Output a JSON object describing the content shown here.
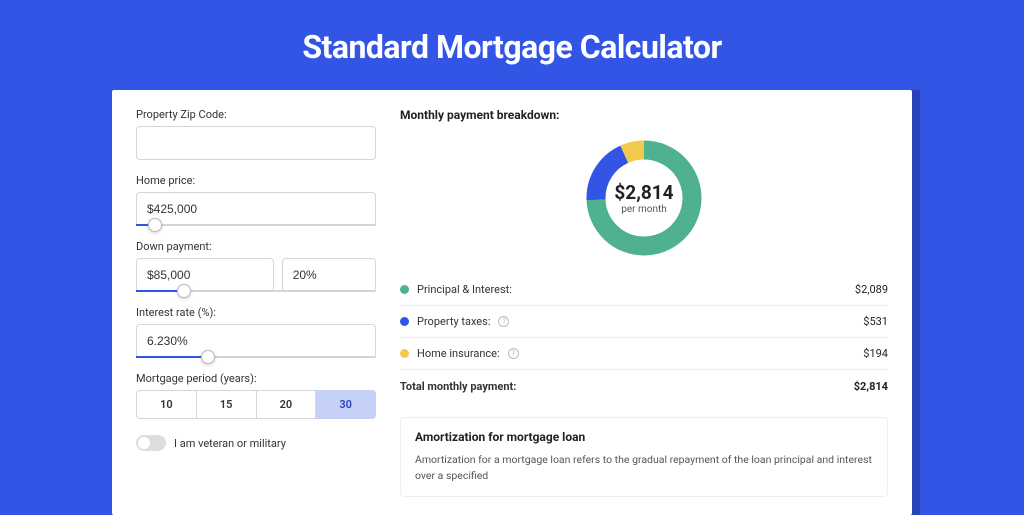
{
  "title": "Standard Mortgage Calculator",
  "form": {
    "zip": {
      "label": "Property Zip Code:",
      "value": ""
    },
    "home_price": {
      "label": "Home price:",
      "value": "$425,000",
      "slider_pct": 8
    },
    "down_payment": {
      "label": "Down payment:",
      "amount": "$85,000",
      "pct": "20%",
      "slider_pct": 20
    },
    "interest": {
      "label": "Interest rate (%):",
      "value": "6.230%",
      "slider_pct": 30
    },
    "period": {
      "label": "Mortgage period (years):",
      "options": [
        "10",
        "15",
        "20",
        "30"
      ],
      "selected": "30"
    },
    "veteran": {
      "label": "I am veteran or military",
      "on": false
    }
  },
  "breakdown": {
    "title": "Monthly payment breakdown:",
    "center_value": "$2,814",
    "center_sub": "per month",
    "items": [
      {
        "label": "Principal & Interest:",
        "value": "$2,089",
        "color": "#4fb18d",
        "help": false
      },
      {
        "label": "Property taxes:",
        "value": "$531",
        "color": "#3355e6",
        "help": true
      },
      {
        "label": "Home insurance:",
        "value": "$194",
        "color": "#f2c94c",
        "help": true
      }
    ],
    "total_label": "Total monthly payment:",
    "total_value": "$2,814"
  },
  "amortization": {
    "title": "Amortization for mortgage loan",
    "text": "Amortization for a mortgage loan refers to the gradual repayment of the loan principal and interest over a specified"
  },
  "chart_data": {
    "type": "pie",
    "title": "Monthly payment breakdown",
    "series": [
      {
        "name": "Principal & Interest",
        "value": 2089,
        "color": "#4fb18d"
      },
      {
        "name": "Property taxes",
        "value": 531,
        "color": "#3355e6"
      },
      {
        "name": "Home insurance",
        "value": 194,
        "color": "#f2c94c"
      }
    ],
    "total": 2814,
    "center_label": "$2,814 per month"
  }
}
